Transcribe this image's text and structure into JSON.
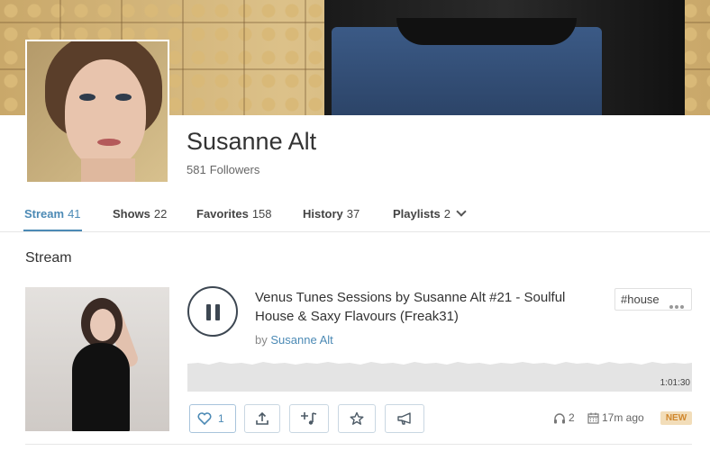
{
  "profile": {
    "name": "Susanne Alt",
    "followers_count": "581",
    "followers_label": "Followers"
  },
  "tabs": [
    {
      "label": "Stream",
      "count": "41",
      "active": true
    },
    {
      "label": "Shows",
      "count": "22"
    },
    {
      "label": "Favorites",
      "count": "158"
    },
    {
      "label": "History",
      "count": "37"
    },
    {
      "label": "Playlists",
      "count": "2"
    }
  ],
  "stream": {
    "section_title": "Stream",
    "track": {
      "title": "Venus Tunes Sessions by Susanne Alt #21 - Soulful House & Saxy Flavours (Freak31)",
      "by_prefix": "by",
      "artist": "Susanne Alt",
      "tag": "#house",
      "duration": "1:01:30",
      "likes": "1",
      "listens": "2",
      "time_ago": "17m ago",
      "badge": "NEW"
    }
  },
  "icons": {
    "play_state": "pause-icon",
    "like": "heart-icon",
    "share": "share-icon",
    "add_to_playlist": "add-to-playlist-icon",
    "favorite": "star-icon",
    "repost": "megaphone-icon",
    "listens": "headphones-icon",
    "date": "calendar-icon",
    "more": "ellipsis-icon",
    "tabs_more": "chevron-down-icon"
  },
  "colors": {
    "accent": "#4c8ab5",
    "badge_bg": "#f2ddb9",
    "badge_text": "#d0872d"
  }
}
